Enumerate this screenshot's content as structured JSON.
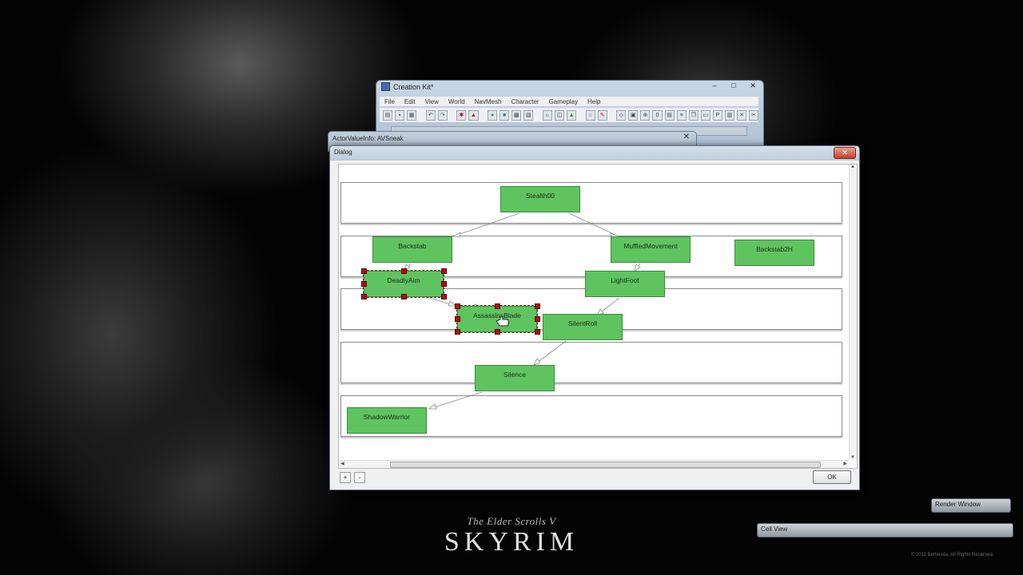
{
  "branding": {
    "subtitle": "The Elder Scrolls V",
    "title": "SKYRIM",
    "copyright": "© 2011 Bethesda. All Rights Reserved."
  },
  "ck_window": {
    "title": "Creation Kit*",
    "menu": [
      "File",
      "Edit",
      "View",
      "World",
      "NavMesh",
      "Character",
      "Gameplay",
      "Help"
    ],
    "controls": {
      "minimize": "–",
      "maximize": "□",
      "close": "✕"
    }
  },
  "avi_window": {
    "title": "ActorValueInfo: AVSneak",
    "close": "✕"
  },
  "dialog": {
    "title": "Dialog",
    "close": "✕",
    "zoom_in": "+",
    "zoom_out": "-",
    "ok": "OK",
    "perks": [
      {
        "id": "stealth00",
        "label": "Stealth00",
        "selected": false
      },
      {
        "id": "backstab",
        "label": "Backstab",
        "selected": false
      },
      {
        "id": "muffledmovement",
        "label": "MuffledMovement",
        "selected": false
      },
      {
        "id": "backstab2h",
        "label": "Backstab2H",
        "selected": false
      },
      {
        "id": "deadlyaim",
        "label": "DeadlyAim",
        "selected": true
      },
      {
        "id": "lightfoot",
        "label": "LightFoot",
        "selected": false
      },
      {
        "id": "assassinsblade",
        "label": "AssassinsBlade",
        "selected": true
      },
      {
        "id": "silentroll",
        "label": "SilentRoll",
        "selected": false
      },
      {
        "id": "silence",
        "label": "Silence",
        "selected": false
      },
      {
        "id": "shadowwarrior",
        "label": "ShadowWarrior",
        "selected": false
      }
    ]
  },
  "side_panels": {
    "render_window": "Render Window",
    "cell_view": "Cell View"
  },
  "colors": {
    "perk_fill": "#5fc45f",
    "handle": "#b01010",
    "desktop": "#040404"
  }
}
